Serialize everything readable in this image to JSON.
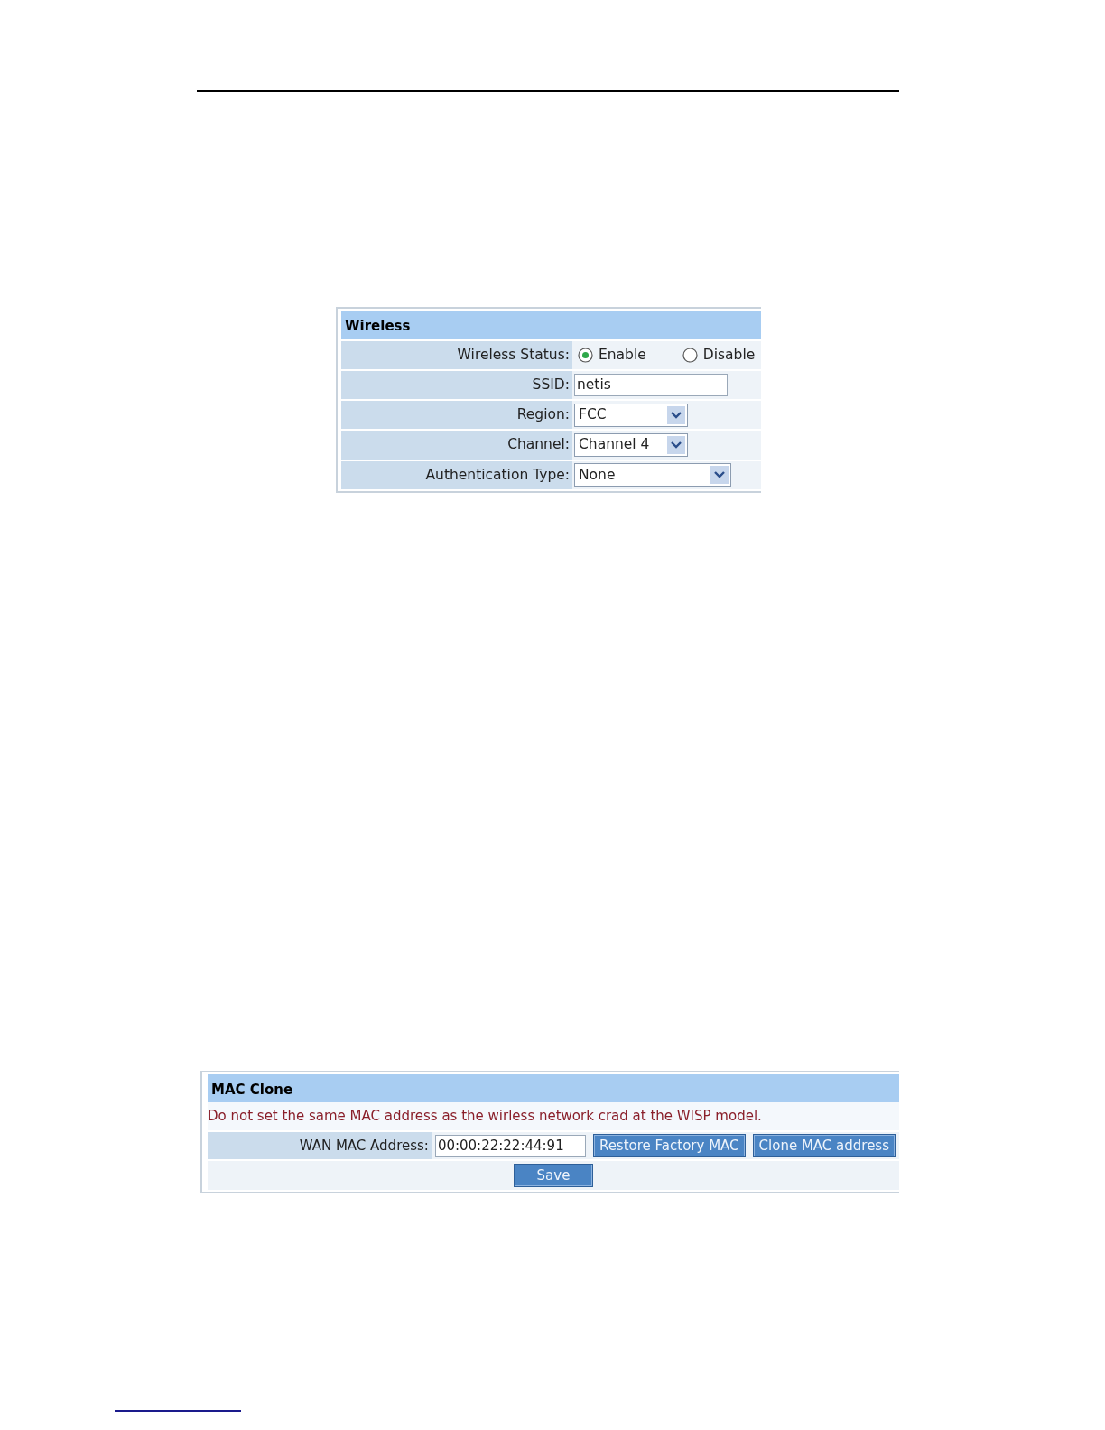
{
  "wireless": {
    "title": "Wireless",
    "status": {
      "label": "Wireless Status:",
      "options": [
        {
          "label": "Enable",
          "selected": true
        },
        {
          "label": "Disable",
          "selected": false
        }
      ]
    },
    "fields": [
      {
        "kind": "text",
        "label": "SSID:",
        "value": "netis"
      },
      {
        "kind": "select",
        "label": "Region:",
        "value": "FCC"
      },
      {
        "kind": "select",
        "label": "Channel:",
        "value": "Channel 4"
      },
      {
        "kind": "select",
        "label": "Authentication Type:",
        "value": "None"
      }
    ]
  },
  "mac_clone": {
    "title": "MAC Clone",
    "warning": "Do not set the same MAC address as the wirless network crad at the WISP model.",
    "field": {
      "label": "WAN MAC Address:",
      "value": "00:00:22:22:44:91"
    },
    "buttons": [
      "Restore Factory MAC",
      "Clone MAC address"
    ],
    "save": "Save"
  }
}
